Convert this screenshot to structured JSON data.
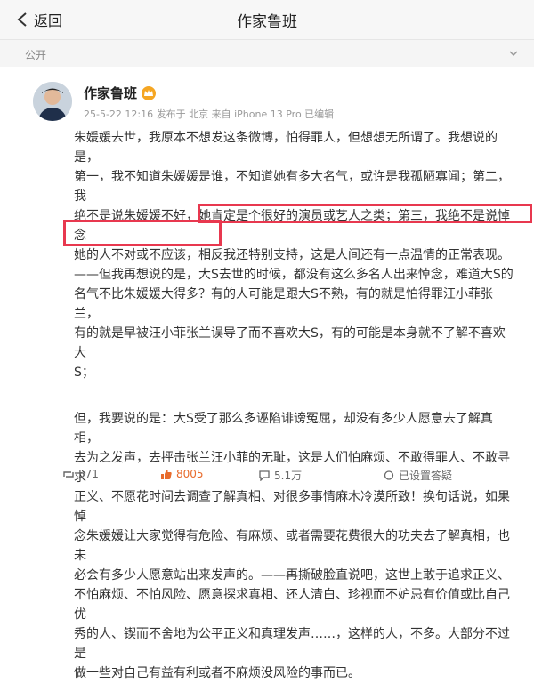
{
  "nav": {
    "back_label": "返回",
    "title": "作家鲁班"
  },
  "section": {
    "label": "公开"
  },
  "post": {
    "author": "作家鲁班",
    "meta": "25-5-22 12:16 发布于 北京 来自 iPhone 13 Pro 已编辑",
    "lines": [
      "朱媛媛去世，我原本不想发这条微博，怕得罪人，但想想无所谓了。我想说的是，",
      "第一，我不知道朱媛媛是谁，不知道她有多大名气，或许是我孤陋寡闻；第二，我",
      "绝不是说朱媛媛不好，她肯定是个很好的演员或艺人之类；第三，我绝不是说悼念",
      "她的人不对或不应该，相反我还特别支持，这是人间还有一点温情的正常表现。",
      "——但我再想说的是，大S去世的时候，都没有这么多名人出来悼念，难道大S的",
      "名气不比朱媛媛大得多？有的人可能是跟大S不熟，有的就是怕得罪汪小菲张兰，",
      "有的就是早被汪小菲张兰误导了而不喜欢大S，有的可能是本身就不了解不喜欢大",
      "S；"
    ],
    "lines2": [
      "但，我要说的是：大S受了那么多诬陷诽谤冤屈，却没有多少人愿意去了解真相，",
      "去为之发声，去抨击张兰汪小菲的无耻，这是人们怕麻烦、不敢得罪人、不敢寻求",
      "正义、不愿花时间去调查了解真相、对很多事情麻木冷漠所致！换句话说，如果悼",
      "念朱媛媛让大家觉得有危险、有麻烦、或者需要花费很大的功夫去了解真相，也未",
      "必会有多少人愿意站出来发声的。——再撕破脸直说吧，这世上敢于追求正义、",
      "不怕麻烦、不怕风险、愿意探求真相、还人清白、珍视而不妒忌有价值或比自己优",
      "秀的人、锲而不舍地为公平正义和真理发声……，这样的人，不多。大部分不过是",
      "做一些对自己有益有利或者不麻烦没风险的事而已。"
    ]
  },
  "actions": {
    "repost": "571",
    "like": "8005",
    "comment": "5.1万",
    "extra": "已设置答疑"
  },
  "colors": {
    "highlight": "#e8384f",
    "like": "#e86b2c"
  }
}
